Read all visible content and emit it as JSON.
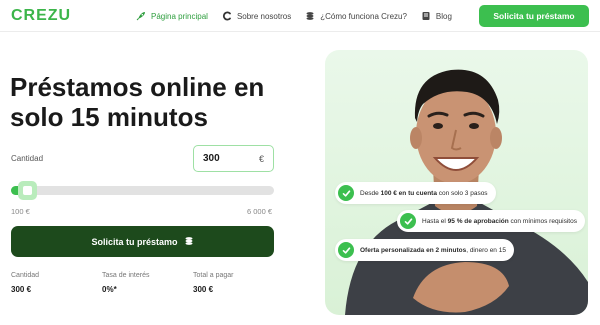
{
  "header": {
    "logo": "CREZU",
    "nav": [
      {
        "label": "Página principal",
        "icon": "rocket-icon",
        "active": true
      },
      {
        "label": "Sobre nosotros",
        "icon": "brand-c-icon",
        "active": false
      },
      {
        "label": "¿Cómo funciona Crezu?",
        "icon": "coins-icon",
        "active": false
      },
      {
        "label": "Blog",
        "icon": "book-icon",
        "active": false
      }
    ],
    "cta": "Solicita tu préstamo"
  },
  "hero": {
    "title": "Préstamos online en solo 15 minutos"
  },
  "calculator": {
    "amount_label": "Cantidad",
    "amount_value": "300",
    "currency_symbol": "€",
    "slider_fraction": 0.034,
    "range_min": "100 €",
    "range_max": "6 000 €",
    "cta": "Solicita tu préstamo",
    "cta_icon": "coins-icon"
  },
  "summary": [
    {
      "label": "Cantidad",
      "value": "300 €"
    },
    {
      "label": "Tasa de interés",
      "value": "0%*"
    },
    {
      "label": "Total a pagar",
      "value": "300 €"
    }
  ],
  "features": [
    {
      "pre": "Desde ",
      "bold": "100 € en tu cuenta",
      "post": " con solo 3 pasos"
    },
    {
      "pre": "Hasta el ",
      "bold": "95 % de aprobación",
      "post": " con mínimos requisitos"
    },
    {
      "pre": "",
      "bold": "Oferta personalizada en 2 minutos",
      "post": ", dinero en 15"
    }
  ],
  "colors": {
    "brand": "#3cbf4f",
    "dark_cta": "#1d4a1c",
    "card_bg": "#dff3dc"
  }
}
